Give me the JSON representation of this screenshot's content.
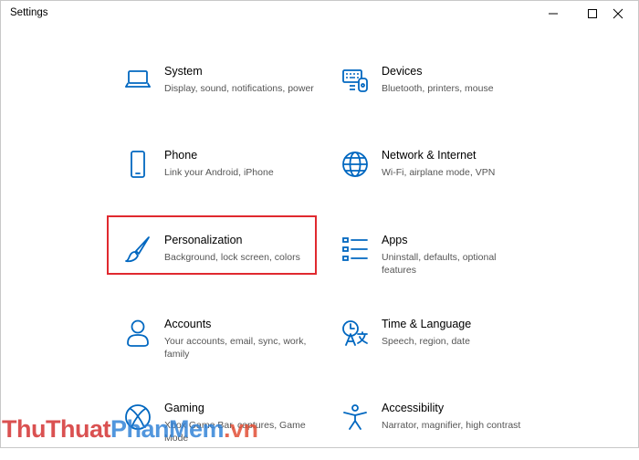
{
  "window": {
    "title": "Settings",
    "controls": [
      "minimize",
      "maximize",
      "close"
    ]
  },
  "settings_items": [
    {
      "title": "System",
      "description": "Display, sound, notifications, power",
      "icon": "laptop-icon"
    },
    {
      "title": "Devices",
      "description": "Bluetooth, printers, mouse",
      "icon": "devices-icon"
    },
    {
      "title": "Phone",
      "description": "Link your Android, iPhone",
      "icon": "phone-icon"
    },
    {
      "title": "Network & Internet",
      "description": "Wi-Fi, airplane mode, VPN",
      "icon": "globe-icon"
    },
    {
      "title": "Personalization",
      "description": "Background, lock screen, colors",
      "icon": "paintbrush-icon",
      "highlighted": true
    },
    {
      "title": "Apps",
      "description": "Uninstall, defaults, optional features",
      "icon": "apps-list-icon"
    },
    {
      "title": "Accounts",
      "description": "Your accounts, email, sync, work, family",
      "icon": "person-icon"
    },
    {
      "title": "Time & Language",
      "description": "Speech, region, date",
      "icon": "time-language-icon"
    },
    {
      "title": "Gaming",
      "description": "Xbox Game Bar, captures, Game Mode",
      "icon": "xbox-icon"
    },
    {
      "title": "Accessibility",
      "description": "Narrator, magnifier, high contrast",
      "icon": "accessibility-icon"
    }
  ],
  "watermark": {
    "part1": "Thu",
    "part2": "Thuat",
    "part3": "PhanMem",
    "suffix": ".vn"
  },
  "colors": {
    "accent": "#0067c0",
    "highlight_border": "#e0292f",
    "description_text": "#555555"
  }
}
